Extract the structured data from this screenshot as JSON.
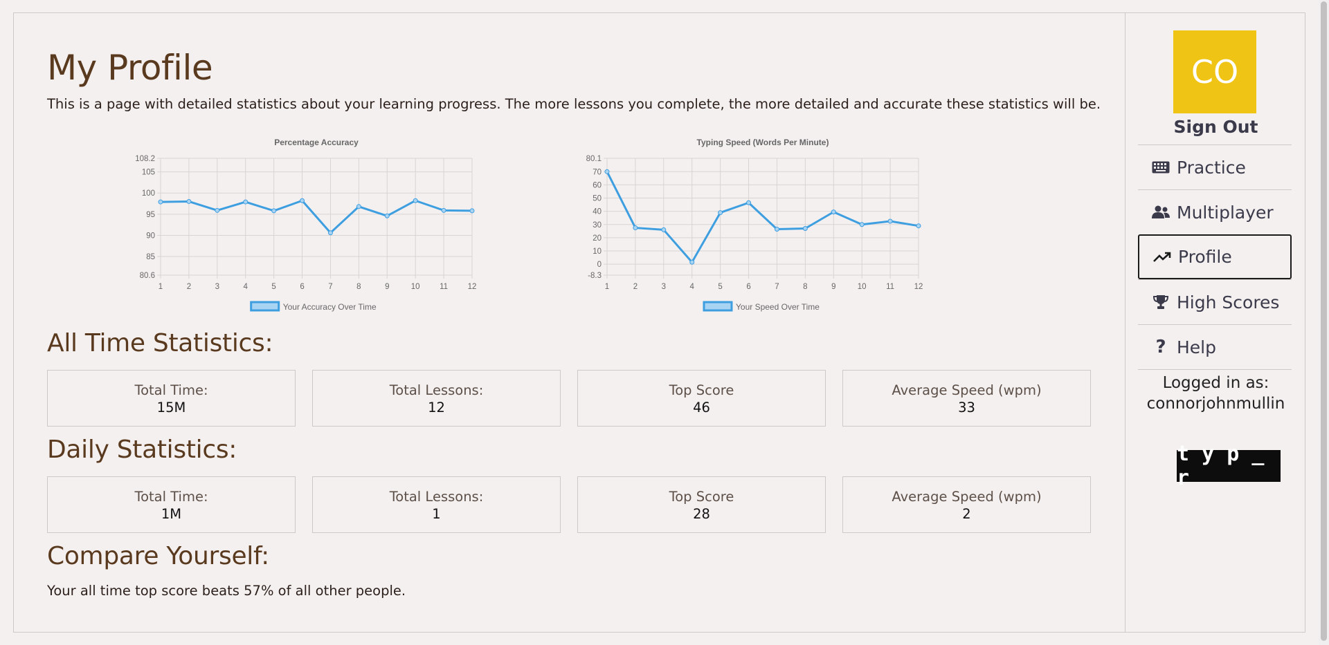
{
  "page": {
    "title": "My Profile",
    "intro": "This is a page with detailed statistics about your learning progress. The more lessons you complete, the more detailed and accurate these statistics will be."
  },
  "charts": [
    {
      "type": "line",
      "title": "Percentage Accuracy",
      "legend": "Your Accuracy Over Time",
      "x": [
        1,
        2,
        3,
        4,
        5,
        6,
        7,
        8,
        9,
        10,
        11,
        12
      ],
      "values": [
        97.9,
        98.0,
        95.9,
        97.9,
        95.8,
        98.2,
        90.6,
        96.8,
        94.6,
        98.2,
        95.9,
        95.8
      ],
      "ylim": [
        80.6,
        108.2
      ],
      "yticks": [
        80.6,
        85,
        90,
        95,
        100,
        105,
        108.2
      ],
      "color": "#3d9ee0"
    },
    {
      "type": "line",
      "title": "Typing Speed (Words Per Minute)",
      "legend": "Your Speed Over Time",
      "x": [
        1,
        2,
        3,
        4,
        5,
        6,
        7,
        8,
        9,
        10,
        11,
        12
      ],
      "values": [
        70,
        27.5,
        26,
        1.5,
        39,
        46.5,
        26.5,
        27,
        39.5,
        30,
        32.5,
        29
      ],
      "ylim": [
        -8.3,
        80.1
      ],
      "yticks": [
        -8.3,
        0,
        10,
        20,
        30,
        40,
        50,
        60,
        70,
        80.1
      ],
      "color": "#3d9ee0"
    }
  ],
  "all_time": {
    "title": "All Time Statistics:",
    "stats": [
      {
        "label": "Total Time:",
        "value": "15M"
      },
      {
        "label": "Total Lessons:",
        "value": "12"
      },
      {
        "label": "Top Score",
        "value": "46"
      },
      {
        "label": "Average Speed (wpm)",
        "value": "33"
      }
    ]
  },
  "daily": {
    "title": "Daily Statistics:",
    "stats": [
      {
        "label": "Total Time:",
        "value": "1M"
      },
      {
        "label": "Total Lessons:",
        "value": "1"
      },
      {
        "label": "Top Score",
        "value": "28"
      },
      {
        "label": "Average Speed (wpm)",
        "value": "2"
      }
    ]
  },
  "compare": {
    "title": "Compare Yourself:",
    "text": "Your all time top score beats 57% of all other people."
  },
  "sidebar": {
    "avatar_initials": "CO",
    "avatar_color": "#f0c414",
    "sign_out": "Sign Out",
    "nav": [
      {
        "label": "Practice",
        "icon": "keyboard-icon",
        "active": false
      },
      {
        "label": "Multiplayer",
        "icon": "users-icon",
        "active": false
      },
      {
        "label": "Profile",
        "icon": "trending-up-icon",
        "active": true
      },
      {
        "label": "High Scores",
        "icon": "trophy-icon",
        "active": false
      },
      {
        "label": "Help",
        "icon": "question-icon",
        "active": false
      }
    ],
    "logged_in_label": "Logged in as:",
    "username": "connorjohnmullin",
    "logo": "t y p _ r"
  }
}
